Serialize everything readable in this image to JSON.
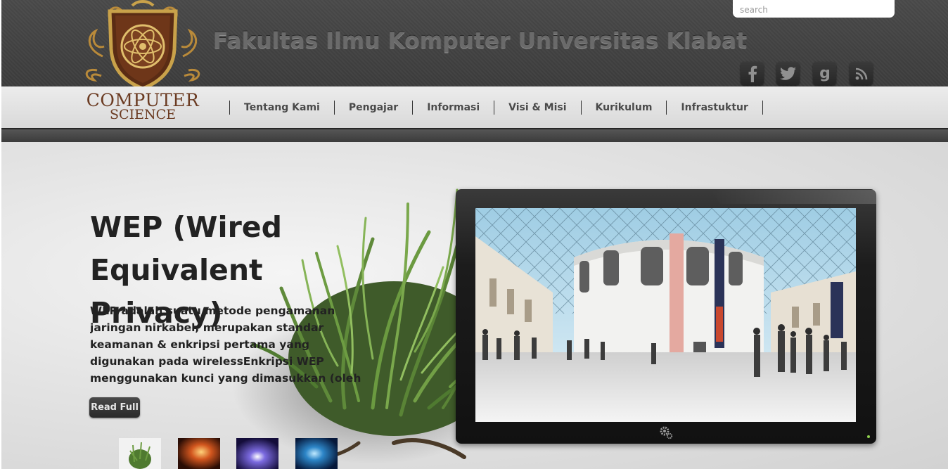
{
  "header": {
    "site_title": "Fakultas Ilmu Komputer Universitas Klabat",
    "search_placeholder": "search",
    "logo_line1": "COMPUTER",
    "logo_line2": "SCIENCE",
    "social": [
      {
        "name": "facebook",
        "icon": "facebook-icon",
        "glyph": "f"
      },
      {
        "name": "twitter",
        "icon": "twitter-icon",
        "glyph": ""
      },
      {
        "name": "google",
        "icon": "google-icon",
        "glyph": "g"
      },
      {
        "name": "rss",
        "icon": "rss-icon",
        "glyph": ""
      }
    ]
  },
  "nav": {
    "items": [
      {
        "label": "Tentang Kami"
      },
      {
        "label": "Pengajar"
      },
      {
        "label": "Informasi"
      },
      {
        "label": "Visi & Misi"
      },
      {
        "label": "Kurikulum"
      },
      {
        "label": "Infrastuktur"
      }
    ]
  },
  "hero": {
    "title": "WEP (Wired Equivalent Privacy)",
    "description": "WEP adalah suatu metode pengamanan jaringan nirkabel, merupakan standar keamanan & enkripsi pertama yang digunakan pada wirelessEnkripsi WEP menggunakan kunci yang dimasukkan (oleh administrator)",
    "read_more": "Read Full"
  },
  "colors": {
    "header_bg": "#444444",
    "nav_bg": "#e0e0e0",
    "logo_brown": "#6b3b22",
    "logo_gold": "#c9a24a"
  }
}
